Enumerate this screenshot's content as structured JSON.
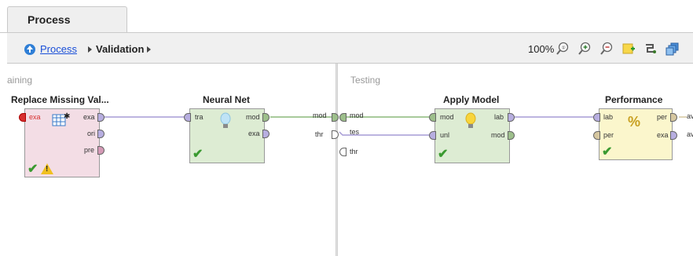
{
  "tab": {
    "label": "Process"
  },
  "breadcrumb": {
    "root": "Process",
    "current": "Validation"
  },
  "toolbar": {
    "zoom": "100%"
  },
  "sections": {
    "training": "aining",
    "testing": "Testing"
  },
  "operators": {
    "replace_missing": {
      "title": "Replace Missing Val...",
      "in_ports": [
        "exa"
      ],
      "out_ports": [
        "exa",
        "ori",
        "pre"
      ]
    },
    "neural_net": {
      "title": "Neural Net",
      "in_ports": [
        "tra"
      ],
      "out_ports": [
        "mod",
        "exa"
      ]
    },
    "apply_model": {
      "title": "Apply Model",
      "in_ports": [
        "mod",
        "unl"
      ],
      "out_ports": [
        "lab",
        "mod"
      ]
    },
    "performance": {
      "title": "Performance",
      "in_ports": [
        "lab",
        "per"
      ],
      "out_ports": [
        "per",
        "exa"
      ]
    }
  },
  "training_side": {
    "out_ports": [
      "mod",
      "thr"
    ]
  },
  "testing_side": {
    "in_ports": [
      "mod",
      "tes",
      "thr"
    ]
  },
  "performance_side": {
    "out_labels": [
      "av",
      "av"
    ]
  },
  "colors": {
    "link": "#1a4fd8",
    "wire_purple": "#a69bd6",
    "wire_green": "#8cb87a"
  }
}
